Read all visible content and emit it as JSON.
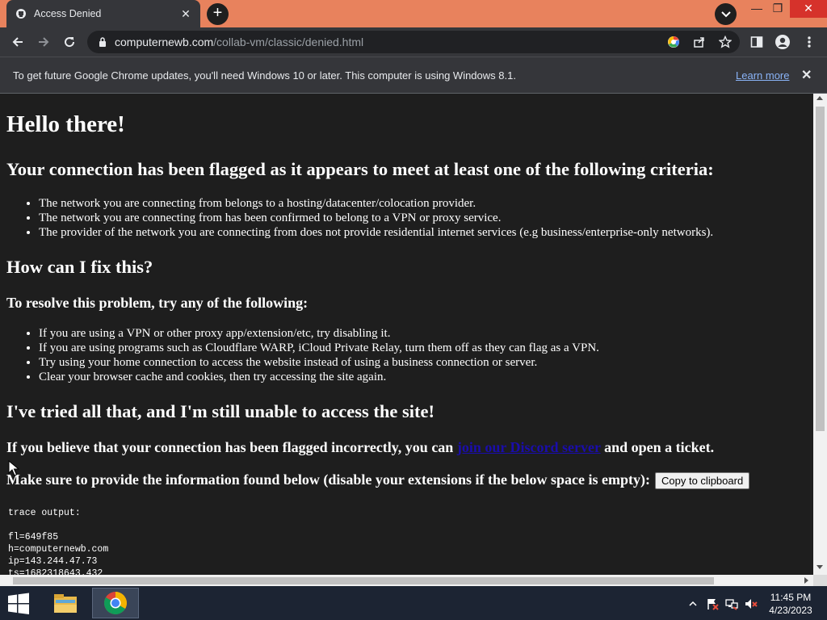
{
  "browser": {
    "tab": {
      "title": "Access Denied",
      "close_label": "✕"
    },
    "new_tab_label": "+",
    "window_controls": {
      "minimize": "—",
      "maximize": "❐",
      "close": "✕"
    },
    "address": {
      "host": "computernewb.com",
      "path": "/collab-vm/classic/denied.html"
    },
    "infobar": {
      "text": "To get future Google Chrome updates, you'll need Windows 10 or later. This computer is using Windows 8.1.",
      "link": "Learn more",
      "close_label": "✕"
    }
  },
  "page": {
    "heading": "Hello there!",
    "flagged_heading": "Your connection has been flagged as it appears to meet at least one of the following criteria:",
    "criteria": [
      "The network you are connecting from belongs to a hosting/datacenter/colocation provider.",
      "The network you are connecting from has been confirmed to belong to a VPN or proxy service.",
      "The provider of the network you are connecting from does not provide residential internet services (e.g business/enterprise-only networks)."
    ],
    "fix_heading": "How can I fix this?",
    "resolve_heading": "To resolve this problem, try any of the following:",
    "fixes": [
      "If you are using a VPN or other proxy app/extension/etc, try disabling it.",
      "If you are using programs such as Cloudflare WARP, iCloud Private Relay, turn them off as they can flag as a VPN.",
      "Try using your home connection to access the website instead of using a business connection or server.",
      "Clear your browser cache and cookies, then try accessing the site again."
    ],
    "still_heading": "I've tried all that, and I'm still unable to access the site!",
    "incorrect_prefix": "If you believe that your connection has been flagged incorrectly, you can",
    "discord_link": "join our Discord server",
    "incorrect_suffix": "and open a ticket.",
    "provide_text": "Make sure to provide the information found below (disable your extensions if the below space is empty):",
    "copy_button": "Copy to clipboard",
    "trace": {
      "label": "trace output:",
      "lines": [
        "fl=649f85",
        "h=computernewb.com",
        "ip=143.244.47.73",
        "ts=1682318643.432"
      ]
    }
  },
  "taskbar": {
    "time": "11:45 PM",
    "date": "4/23/2023"
  },
  "colors": {
    "titlebar": "#e8825d",
    "toolbar": "#35363a",
    "page_bg": "#1e1e1e",
    "link": "#1a0dab",
    "taskbar": "#1c2433"
  }
}
